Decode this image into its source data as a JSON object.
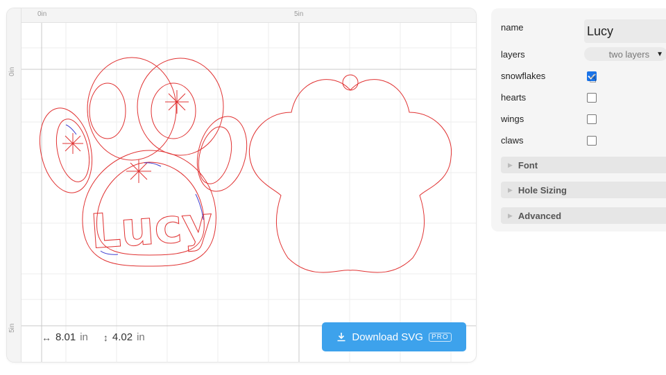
{
  "canvas": {
    "ruler_top_labels": [
      "0in",
      "5in"
    ],
    "ruler_left_labels": [
      "0in",
      "5in"
    ],
    "dimensions": {
      "width_value": "8.01",
      "width_unit": "in",
      "height_value": "4.02",
      "height_unit": "in"
    },
    "download_button": {
      "label": "Download SVG",
      "badge": "PRO",
      "color": "#3da2ec"
    },
    "design": {
      "name_text": "Lucy",
      "stroke_color": "#e03030",
      "accent_stroke_color": "#4040d0"
    }
  },
  "settings": {
    "fields": [
      {
        "label": "name",
        "value": "Lucy"
      },
      {
        "label": "layers",
        "value": "two layers"
      }
    ],
    "checkboxes": [
      {
        "label": "snowflakes",
        "checked": true
      },
      {
        "label": "hearts",
        "checked": false
      },
      {
        "label": "wings",
        "checked": false
      },
      {
        "label": "claws",
        "checked": false
      }
    ],
    "sections": [
      "Font",
      "Hole Sizing",
      "Advanced"
    ]
  }
}
